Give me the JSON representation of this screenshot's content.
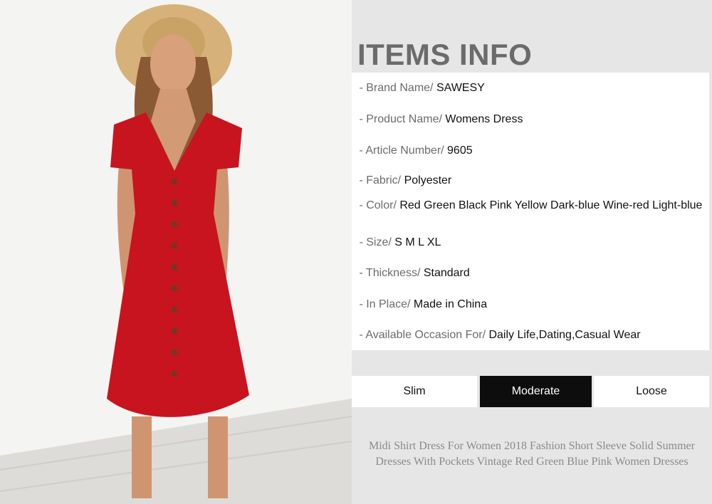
{
  "title": "ITEMS INFO",
  "rows": [
    {
      "label": " - Brand Name/ ",
      "value": "SAWESY"
    },
    {
      "label": " - Product Name/ ",
      "value": "Womens Dress"
    },
    {
      "label": " - Article Number/ ",
      "value": "9605"
    },
    {
      "label": " - Fabric/ ",
      "value": "Polyester"
    },
    {
      "label": " - Color/ ",
      "value": "Red Green Black Pink Yellow Dark-blue Wine-red Light-blue"
    },
    {
      "label": " - Size/ ",
      "value": "S M L XL"
    },
    {
      "label": " - Thickness/ ",
      "value": "Standard"
    },
    {
      "label": " - In Place/ ",
      "value": "Made in China"
    },
    {
      "label": " - Available Occasion For/ ",
      "value": "Daily Life,Dating,Casual Wear"
    }
  ],
  "fit_options": [
    "Slim",
    "Moderate",
    "Loose"
  ],
  "fit_selected": "Moderate",
  "caption": "Midi Shirt Dress For Women 2018 Fashion Short Sleeve Solid Summer Dresses With Pockets Vintage Red Green Blue Pink Women Dresses",
  "colors": {
    "dress": "#c8141e",
    "panel": "#e6e6e6",
    "selected": "#0d0d0d",
    "label": "#6b6b6b"
  }
}
